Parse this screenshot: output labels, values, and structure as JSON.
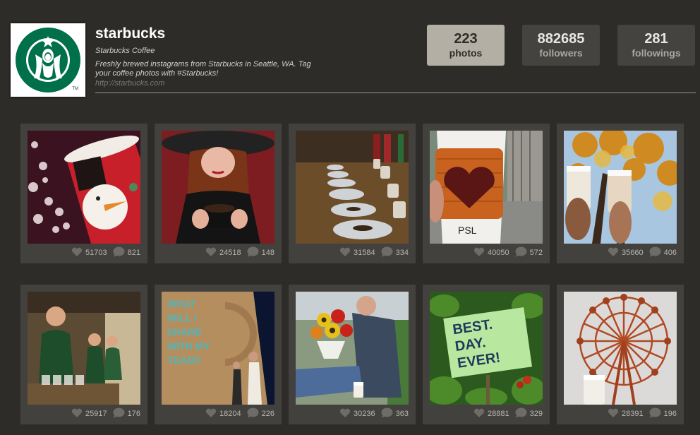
{
  "profile": {
    "username": "starbucks",
    "full_name": "Starbucks Coffee",
    "bio": "Freshly brewed instagrams from Starbucks in Seattle, WA. Tag your coffee photos with #Starbucks!",
    "website": "http://starbucks.com",
    "logo_trademark": "TM"
  },
  "stats": [
    {
      "value": "223",
      "label": "photos"
    },
    {
      "value": "882685",
      "label": "followers"
    },
    {
      "value": "281",
      "label": "followings"
    }
  ],
  "photos": [
    {
      "likes": "51703",
      "comments": "821",
      "scene": "holiday-red-cup"
    },
    {
      "likes": "24518",
      "comments": "148",
      "scene": "woman-holding-mug"
    },
    {
      "likes": "31584",
      "comments": "334",
      "scene": "coffee-tasting-cups"
    },
    {
      "likes": "40050",
      "comments": "572",
      "scene": "psl-knit-sleeve"
    },
    {
      "likes": "35660",
      "comments": "406",
      "scene": "two-cups-autumn-tree"
    },
    {
      "likes": "25917",
      "comments": "176",
      "scene": "barista-serving"
    },
    {
      "likes": "18204",
      "comments": "226",
      "scene": "share-with-my-team-wall"
    },
    {
      "likes": "30236",
      "comments": "363",
      "scene": "man-with-flowers"
    },
    {
      "likes": "28881",
      "comments": "329",
      "scene": "best-day-ever-sign"
    },
    {
      "likes": "28391",
      "comments": "196",
      "scene": "ferris-wheel-cup"
    }
  ],
  "photo_texts": {
    "psl": "PSL",
    "team_wall": [
      "WHAT",
      "WILL I",
      "SHARE",
      "WITH MY",
      "TEAM?"
    ],
    "sign": [
      "BEST.",
      "DAY.",
      "EVER!"
    ]
  },
  "icons": {
    "like": "heart-icon",
    "comment": "speech-bubble-icon"
  },
  "colors": {
    "background": "#2e2c28",
    "card": "#43413d",
    "active_stat": "#b3afa4",
    "brand_green": "#00704a"
  }
}
